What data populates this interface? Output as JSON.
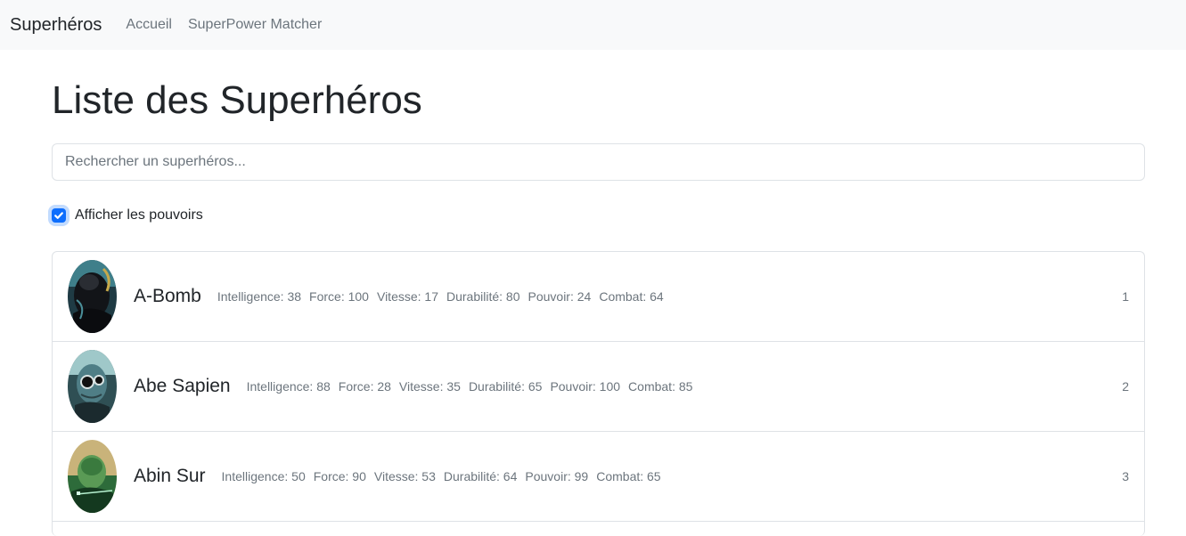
{
  "navbar": {
    "brand": "Superhéros",
    "links": [
      "Accueil",
      "SuperPower Matcher"
    ]
  },
  "page": {
    "title": "Liste des Superhéros",
    "search_placeholder": "Rechercher un superhéros...",
    "show_powers_label": "Afficher les pouvoirs",
    "show_powers_checked": true
  },
  "heroes": [
    {
      "name": "A-Bomb",
      "id": "1",
      "stats": [
        "Intelligence: 38",
        "Force: 100",
        "Vitesse: 17",
        "Durabilité: 80",
        "Pouvoir: 24",
        "Combat: 64"
      ]
    },
    {
      "name": "Abe Sapien",
      "id": "2",
      "stats": [
        "Intelligence: 88",
        "Force: 28",
        "Vitesse: 35",
        "Durabilité: 65",
        "Pouvoir: 100",
        "Combat: 85"
      ]
    },
    {
      "name": "Abin Sur",
      "id": "3",
      "stats": [
        "Intelligence: 50",
        "Force: 90",
        "Vitesse: 53",
        "Durabilité: 64",
        "Pouvoir: 99",
        "Combat: 65"
      ]
    }
  ],
  "colors": {
    "accent": "#0d6efd",
    "navbar_bg": "#f8f9fa",
    "muted_text": "#6c757d",
    "border": "#dee2e6"
  }
}
